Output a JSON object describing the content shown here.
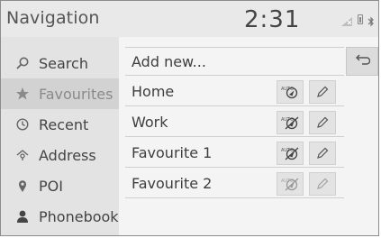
{
  "header": {
    "title": "Navigation",
    "clock": "2:31"
  },
  "sidebar": {
    "items": [
      {
        "label": "Search",
        "icon": "search-icon"
      },
      {
        "label": "Favourites",
        "icon": "star-icon",
        "active": true
      },
      {
        "label": "Recent",
        "icon": "clock-icon"
      },
      {
        "label": "Address",
        "icon": "address-icon"
      },
      {
        "label": "POI",
        "icon": "poi-pin-icon"
      },
      {
        "label": "Phonebook",
        "icon": "person-icon"
      }
    ]
  },
  "main": {
    "add_new_label": "Add new...",
    "rows": [
      {
        "label": "Home",
        "auto_icon": "auto-route-icon",
        "edit_icon": "pencil-icon",
        "auto_crossed": false,
        "dim": false
      },
      {
        "label": "Work",
        "auto_icon": "auto-route-off-icon",
        "edit_icon": "pencil-icon",
        "auto_crossed": true,
        "dim": false
      },
      {
        "label": "Favourite 1",
        "auto_icon": "auto-route-off-icon",
        "edit_icon": "pencil-icon",
        "auto_crossed": true,
        "dim": false
      },
      {
        "label": "Favourite 2",
        "auto_icon": "auto-route-off-icon",
        "edit_icon": "pencil-icon",
        "auto_crossed": true,
        "dim": true
      }
    ],
    "back_icon": "back-arrow-icon"
  }
}
